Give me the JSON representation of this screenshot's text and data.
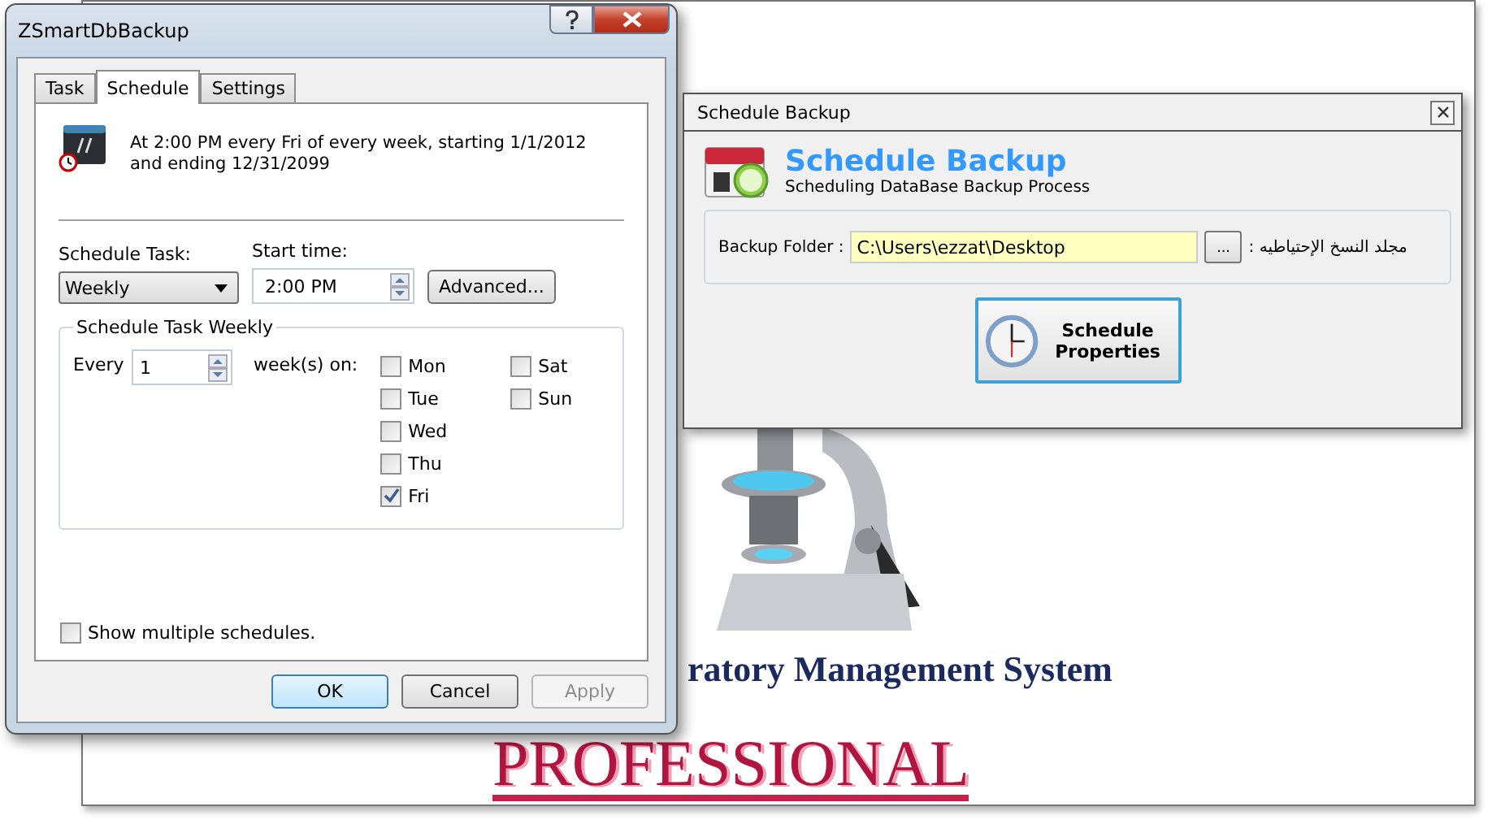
{
  "background_app": {
    "heading": "ratory Management System",
    "subheading": "PROFESSIONAL"
  },
  "task_dialog": {
    "title": "ZSmartDbBackup",
    "tabs": [
      {
        "label": "Task",
        "selected": false
      },
      {
        "label": "Schedule",
        "selected": true
      },
      {
        "label": "Settings",
        "selected": false
      }
    ],
    "summary": "At 2:00 PM every Fri of every week, starting 1/1/2012 and ending 12/31/2099",
    "schedule_task": {
      "label": "Schedule Task:",
      "value": "Weekly"
    },
    "start_time": {
      "label": "Start time:",
      "value": "2:00 PM"
    },
    "advanced_button": "Advanced...",
    "weekly_group": {
      "title": "Schedule Task Weekly",
      "every_label": "Every",
      "every_value": "1",
      "weeks_label": "week(s) on:",
      "days": [
        {
          "label": "Mon",
          "checked": false
        },
        {
          "label": "Tue",
          "checked": false
        },
        {
          "label": "Wed",
          "checked": false
        },
        {
          "label": "Thu",
          "checked": false
        },
        {
          "label": "Fri",
          "checked": true
        },
        {
          "label": "Sat",
          "checked": false
        },
        {
          "label": "Sun",
          "checked": false
        }
      ]
    },
    "show_multiple": {
      "label": "Show multiple schedules.",
      "checked": false
    },
    "buttons": [
      {
        "label": "OK",
        "kind": "default"
      },
      {
        "label": "Cancel",
        "kind": "normal"
      },
      {
        "label": "Apply",
        "kind": "disabled"
      }
    ]
  },
  "backup_window": {
    "title": "Schedule Backup",
    "heading": "Schedule Backup",
    "subtitle": "Scheduling DataBase Backup Process",
    "folder_label": "Backup Folder :",
    "folder_value": "C:\\Users\\ezzat\\Desktop",
    "browse_button": "...",
    "folder_label_arabic": "مجلد النسخ الإحتياطيه :",
    "properties_button": "Schedule Properties"
  }
}
